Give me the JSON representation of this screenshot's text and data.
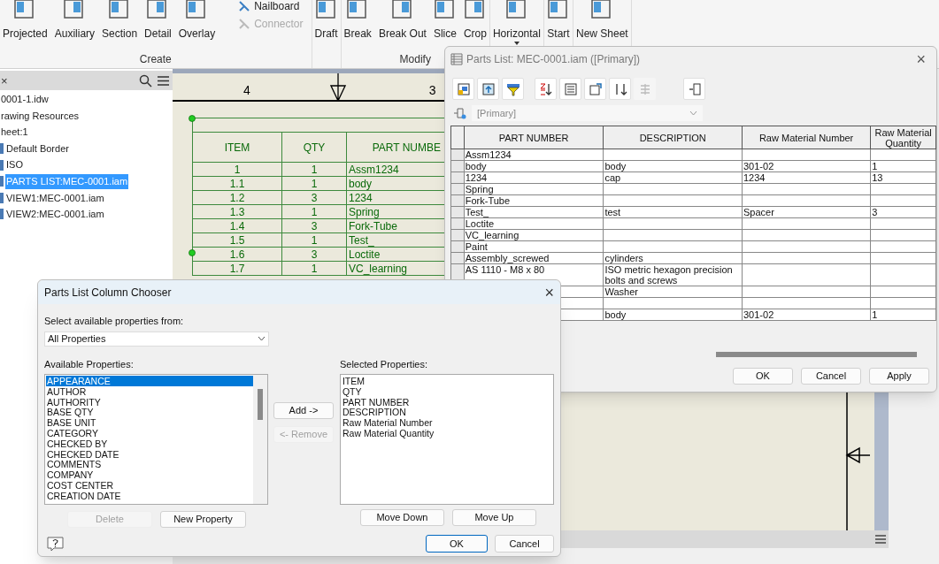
{
  "ribbon": {
    "groups": [
      {
        "label": "Create",
        "tools": [
          {
            "label": "Projected"
          },
          {
            "label": "Auxiliary"
          },
          {
            "label": "Section"
          },
          {
            "label": "Detail"
          },
          {
            "label": "Overlay"
          }
        ],
        "small_tools": [
          {
            "label": "Nailboard",
            "disabled": false
          },
          {
            "label": "Connector",
            "disabled": true
          }
        ]
      },
      {
        "tools": [
          {
            "label": "Draft"
          }
        ]
      },
      {
        "label": "Modify",
        "tools": [
          {
            "label": "Break"
          },
          {
            "label": "Break Out"
          },
          {
            "label": "Slice"
          },
          {
            "label": "Crop"
          }
        ]
      },
      {
        "tools": [
          {
            "label": "Horizontal",
            "dropdown": true
          }
        ]
      },
      {
        "tools": [
          {
            "label": "Start"
          }
        ]
      },
      {
        "tools": [
          {
            "label": "New Sheet"
          }
        ]
      }
    ]
  },
  "browser": {
    "close": "×",
    "items": [
      {
        "label": "0001-1.idw",
        "icon": false,
        "selected": false
      },
      {
        "label": "rawing Resources",
        "icon": false,
        "selected": false
      },
      {
        "label": "heet:1",
        "icon": false,
        "selected": false
      },
      {
        "label": "Default Border",
        "icon": true,
        "selected": false
      },
      {
        "label": "ISO",
        "icon": true,
        "selected": false
      },
      {
        "label": "PARTS LIST:MEC-0001.iam",
        "icon": true,
        "selected": true
      },
      {
        "label": "VIEW1:MEC-0001.iam",
        "icon": true,
        "selected": false
      },
      {
        "label": "VIEW2:MEC-0001.iam",
        "icon": true,
        "selected": false
      }
    ]
  },
  "sheet": {
    "zone_labels": [
      "4",
      "3"
    ],
    "parts_table": {
      "columns": [
        "ITEM",
        "QTY",
        "PART NUMBE"
      ],
      "rows": [
        [
          "1",
          "1",
          "Assm1234"
        ],
        [
          "1.1",
          "1",
          "body"
        ],
        [
          "1.2",
          "3",
          "1234"
        ],
        [
          "1.3",
          "1",
          "Spring"
        ],
        [
          "1.4",
          "3",
          "Fork-Tube"
        ],
        [
          "1.5",
          "1",
          "Test_"
        ],
        [
          "1.6",
          "3",
          "Loctite"
        ],
        [
          "1.7",
          "1",
          "VC_learning"
        ]
      ]
    }
  },
  "parts_list_dialog": {
    "title": "Parts List: MEC-0001.iam ([Primary])",
    "close": "×",
    "toolbar": [
      {
        "disabled": false
      },
      {
        "disabled": false
      },
      {
        "disabled": false
      },
      {
        "disabled": false
      },
      {
        "disabled": false
      },
      {
        "disabled": false
      },
      {
        "disabled": false
      },
      {
        "disabled": true
      },
      {
        "disabled": false
      }
    ],
    "view_combo": {
      "value": "[Primary]",
      "disabled": true
    },
    "columns": [
      "PART NUMBER",
      "DESCRIPTION",
      "Raw Material Number",
      "Raw Material Quantity"
    ],
    "rows": [
      {
        "cells": [
          "Assm1234",
          "",
          "",
          ""
        ]
      },
      {
        "cells": [
          "body",
          "body",
          "301-02",
          "1"
        ]
      },
      {
        "cells": [
          "1234",
          "cap",
          "1234",
          "13"
        ]
      },
      {
        "cells": [
          "Spring",
          "",
          "",
          ""
        ]
      },
      {
        "cells": [
          "Fork-Tube",
          "",
          "",
          ""
        ]
      },
      {
        "cells": [
          "Test_",
          "test",
          "Spacer",
          "3"
        ]
      },
      {
        "cells": [
          "Loctite",
          "",
          "",
          ""
        ]
      },
      {
        "cells": [
          "VC_learning",
          "",
          "",
          ""
        ]
      },
      {
        "cells": [
          "Paint",
          "",
          "",
          ""
        ]
      },
      {
        "cells": [
          "Assembly_screwed",
          "cylinders",
          "",
          ""
        ]
      },
      {
        "cells": [
          "AS 1110 - M8 x 80",
          "ISO metric hexagon precision bolts and screws",
          "",
          ""
        ]
      },
      {
        "cells": [
          "",
          "Washer",
          "",
          ""
        ]
      },
      {
        "cells": [
          "",
          "",
          "",
          ""
        ]
      },
      {
        "cells": [
          "",
          "body",
          "301-02",
          "1"
        ]
      }
    ],
    "buttons": [
      {
        "label": "OK"
      },
      {
        "label": "Cancel"
      },
      {
        "label": "Apply"
      }
    ]
  },
  "column_chooser": {
    "title": "Parts List Column Chooser",
    "close": "×",
    "source_label": "Select available properties from:",
    "source_value": "All Properties",
    "available_label": "Available Properties:",
    "available": [
      {
        "label": "APPEARANCE",
        "selected": true
      },
      {
        "label": "AUTHOR",
        "selected": false
      },
      {
        "label": "AUTHORITY",
        "selected": false
      },
      {
        "label": "BASE QTY",
        "selected": false
      },
      {
        "label": "BASE UNIT",
        "selected": false
      },
      {
        "label": "CATEGORY",
        "selected": false
      },
      {
        "label": "CHECKED BY",
        "selected": false
      },
      {
        "label": "CHECKED DATE",
        "selected": false
      },
      {
        "label": "COMMENTS",
        "selected": false
      },
      {
        "label": "COMPANY",
        "selected": false
      },
      {
        "label": "COST CENTER",
        "selected": false
      },
      {
        "label": "CREATION DATE",
        "selected": false
      }
    ],
    "add": {
      "label": "Add ->",
      "disabled": false
    },
    "remove": {
      "label": "<- Remove",
      "disabled": true
    },
    "selected_label": "Selected Properties:",
    "selected": [
      "ITEM",
      "QTY",
      "PART NUMBER",
      "DESCRIPTION",
      "Raw Material Number",
      "Raw Material Quantity"
    ],
    "delete": {
      "label": "Delete",
      "disabled": true
    },
    "new_property": {
      "label": "New Property",
      "disabled": false
    },
    "move_down": {
      "label": "Move Down"
    },
    "move_up": {
      "label": "Move Up"
    },
    "ok": {
      "label": "OK"
    },
    "cancel": {
      "label": "Cancel"
    }
  }
}
